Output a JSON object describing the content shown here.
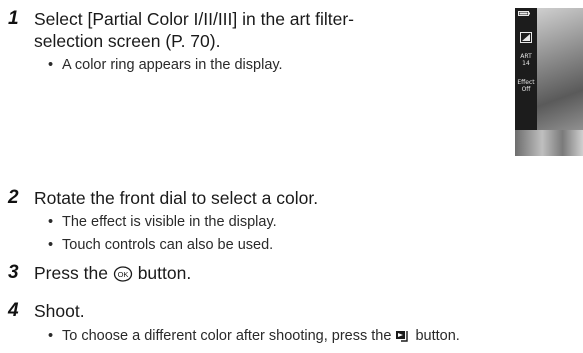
{
  "steps": [
    {
      "number": "1",
      "text_line1": "Select [Partial Color I/II/III] in the art filter-",
      "text_line2": "selection screen (P. 70).",
      "bullets": [
        "A color ring appears in the display."
      ]
    },
    {
      "number": "2",
      "text": "Rotate the front dial to select a color.",
      "bullets": [
        "The effect is visible in the display.",
        "Touch controls can also be used."
      ]
    },
    {
      "number": "3",
      "text_before": "Press the",
      "icon": "ok-button-icon",
      "text_after": "button."
    },
    {
      "number": "4",
      "text": "Shoot.",
      "bullet_before": "To choose a different color after shooting, press the",
      "bullet_icon": "playback-button-icon",
      "bullet_after": "button."
    }
  ],
  "screen": {
    "menu_items": [
      "ART",
      "14",
      "Effect",
      "Off"
    ]
  }
}
